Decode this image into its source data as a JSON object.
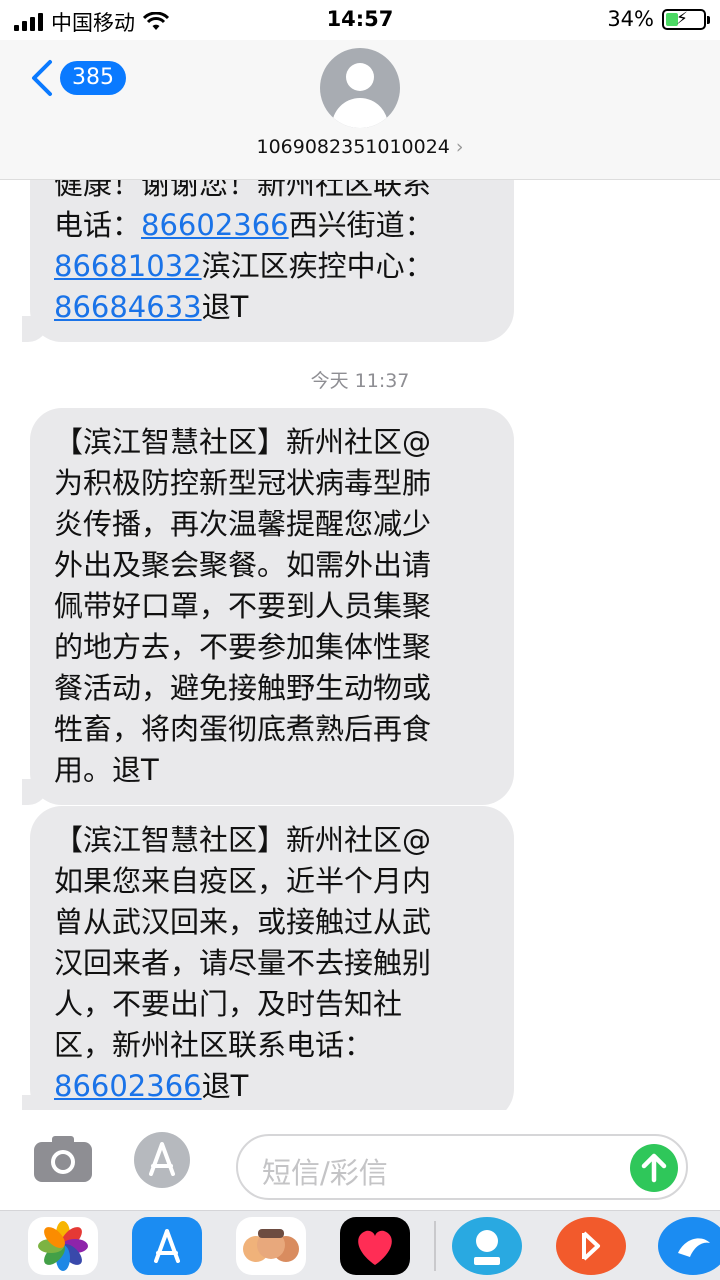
{
  "status": {
    "carrier": "中国移动",
    "time": "14:57",
    "battery": "34%",
    "battery_level": 0.34
  },
  "header": {
    "back_count": "385",
    "sender": "1069082351010024"
  },
  "messages": {
    "m1": {
      "l1": "健康！谢谢您！新州社区联系",
      "l2a": "电话：",
      "l2b": "86602366",
      "l2c": "西兴街道：",
      "l3a": "86681032",
      "l3b": "滨江区疾控中心：",
      "l4a": "86684633",
      "l4b": "退T"
    },
    "timestamp": {
      "day": "今天",
      "time": "11:37"
    },
    "m2": {
      "l1": "【滨江智慧社区】新州社区@",
      "l2": "为积极防控新型冠状病毒型肺",
      "l3": "炎传播，再次温馨提醒您减少",
      "l4": "外出及聚会聚餐。如需外出请",
      "l5": "佩带好口罩，不要到人员集聚",
      "l6": "的地方去，不要参加集体性聚",
      "l7": "餐活动，避免接触野生动物或",
      "l8": "牲畜，将肉蛋彻底煮熟后再食",
      "l9": "用。退T"
    },
    "m3": {
      "l1": "【滨江智慧社区】新州社区@",
      "l2": "如果您来自疫区，近半个月内",
      "l3": "曾从武汉回来，或接触过从武",
      "l4": "汉回来者，请尽量不去接触别",
      "l5": "人，不要出门，及时告知社",
      "l6": "区，新州社区联系电话：",
      "l7a": "86602366",
      "l7b": "退T"
    }
  },
  "compose": {
    "placeholder": "短信/彩信"
  },
  "dock": {
    "apps": [
      "photos-icon",
      "app-store-icon",
      "memoji-icon",
      "digital-touch-icon",
      "migu-icon",
      "music-icon",
      "more-icon"
    ],
    "colors": {
      "accent": "#0a7aff",
      "send": "#2fc75a",
      "bubble": "#e9e9eb"
    }
  }
}
